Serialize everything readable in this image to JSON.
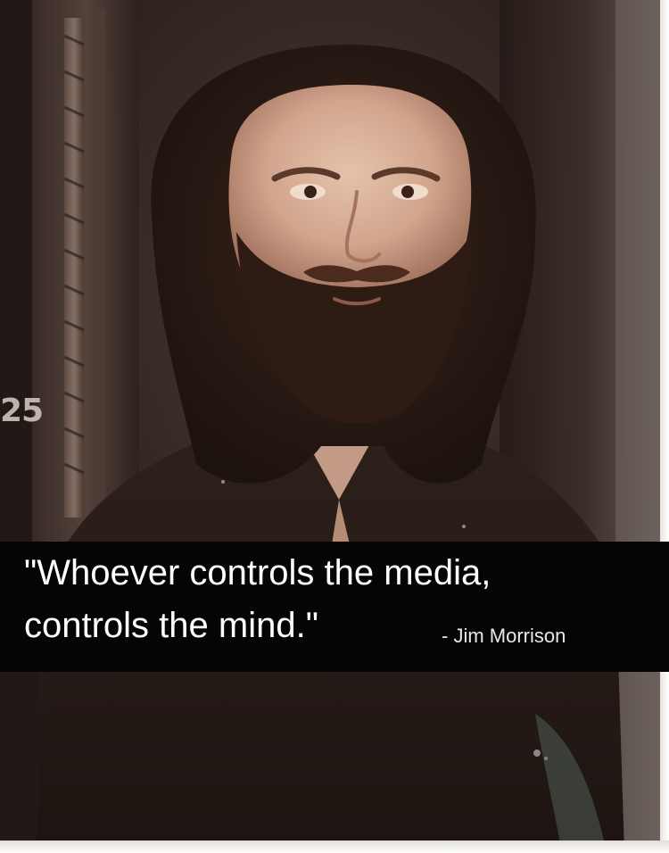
{
  "photo": {
    "subject": "portrait-photo",
    "film_number": "25"
  },
  "caption": {
    "quote_line_1": "\"Whoever controls the media,",
    "quote_line_2": "controls the mind.\"",
    "attribution": "- Jim Morrison"
  },
  "colors": {
    "caption_background": "#050505",
    "caption_text": "#ffffff",
    "photo_tone": "#2a1d18",
    "skin_tone": "#d7ae97",
    "hair_tone": "#2b1a14"
  }
}
